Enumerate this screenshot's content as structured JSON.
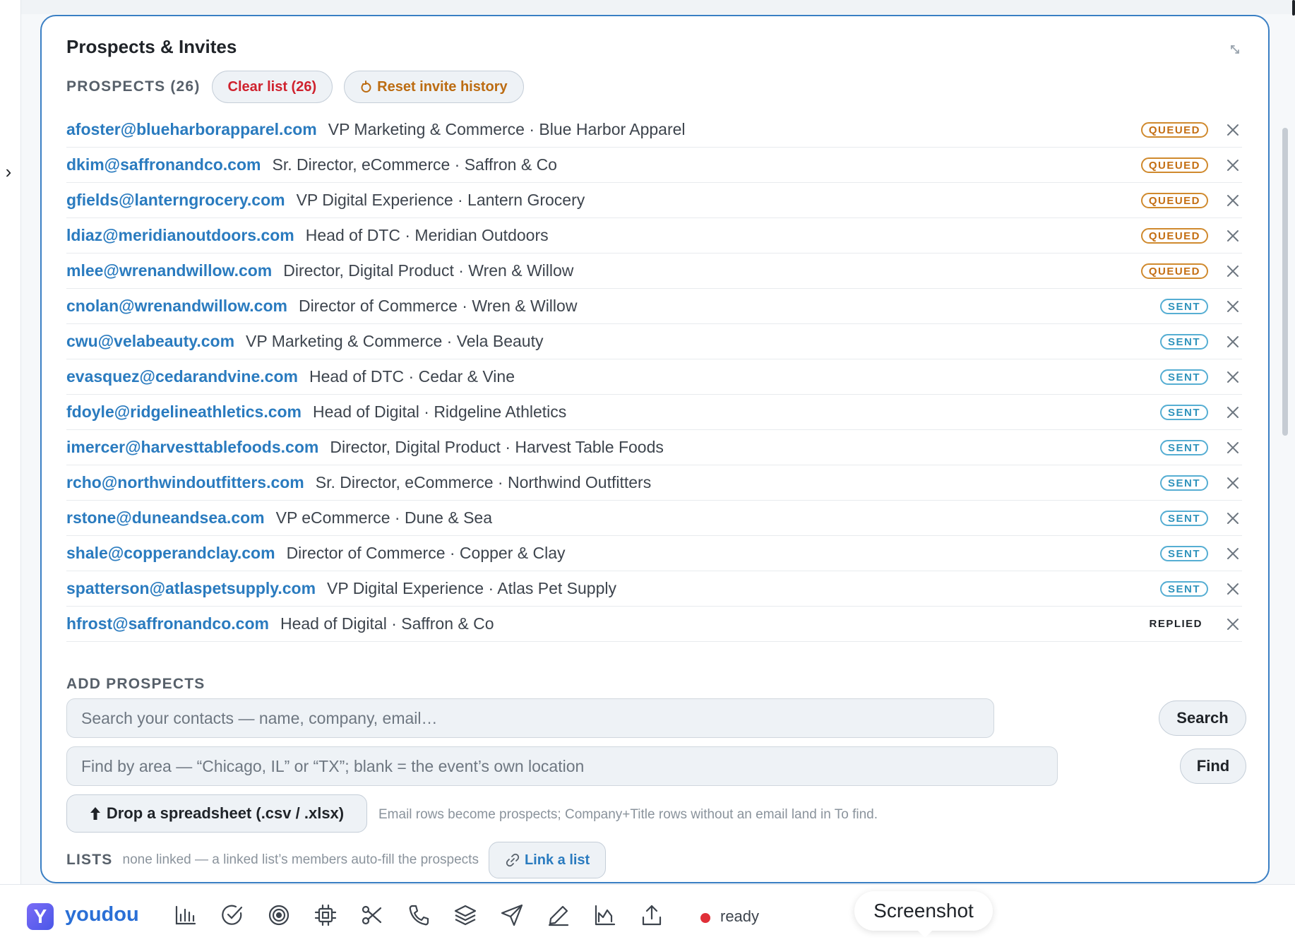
{
  "panel": {
    "title": "Prospects & Invites",
    "prospects_label": "PROSPECTS (26)",
    "clear_button": "Clear list (26)",
    "reset_button": "Reset invite history"
  },
  "prospects": [
    {
      "email": "afoster@blueharborapparel.com",
      "desc": "VP Marketing & Commerce · Blue Harbor Apparel",
      "status": "QUEUED"
    },
    {
      "email": "dkim@saffronandco.com",
      "desc": "Sr. Director, eCommerce · Saffron & Co",
      "status": "QUEUED"
    },
    {
      "email": "gfields@lanterngrocery.com",
      "desc": "VP Digital Experience · Lantern Grocery",
      "status": "QUEUED"
    },
    {
      "email": "ldiaz@meridianoutdoors.com",
      "desc": "Head of DTC · Meridian Outdoors",
      "status": "QUEUED"
    },
    {
      "email": "mlee@wrenandwillow.com",
      "desc": "Director, Digital Product · Wren & Willow",
      "status": "QUEUED"
    },
    {
      "email": "cnolan@wrenandwillow.com",
      "desc": "Director of Commerce · Wren & Willow",
      "status": "SENT"
    },
    {
      "email": "cwu@velabeauty.com",
      "desc": "VP Marketing & Commerce · Vela Beauty",
      "status": "SENT"
    },
    {
      "email": "evasquez@cedarandvine.com",
      "desc": "Head of DTC · Cedar & Vine",
      "status": "SENT"
    },
    {
      "email": "fdoyle@ridgelineathletics.com",
      "desc": "Head of Digital · Ridgeline Athletics",
      "status": "SENT"
    },
    {
      "email": "imercer@harvesttablefoods.com",
      "desc": "Director, Digital Product · Harvest Table Foods",
      "status": "SENT"
    },
    {
      "email": "rcho@northwindoutfitters.com",
      "desc": "Sr. Director, eCommerce · Northwind Outfitters",
      "status": "SENT"
    },
    {
      "email": "rstone@duneandsea.com",
      "desc": "VP eCommerce · Dune & Sea",
      "status": "SENT"
    },
    {
      "email": "shale@copperandclay.com",
      "desc": "Director of Commerce · Copper & Clay",
      "status": "SENT"
    },
    {
      "email": "spatterson@atlaspetsupply.com",
      "desc": "VP Digital Experience · Atlas Pet Supply",
      "status": "SENT"
    },
    {
      "email": "hfrost@saffronandco.com",
      "desc": "Head of Digital · Saffron & Co",
      "status": "REPLIED"
    }
  ],
  "add": {
    "label": "ADD PROSPECTS",
    "search_placeholder": "Search your contacts — name, company, email…",
    "search_button": "Search",
    "area_placeholder": "Find by area — “Chicago, IL” or “TX”; blank = the event’s own location",
    "find_button": "Find",
    "drop_button": "Drop a spreadsheet (.csv / .xlsx)",
    "drop_hint": "Email rows become prospects; Company+Title rows without an email land in To find."
  },
  "lists": {
    "label": "LISTS",
    "hint": "none linked — a linked list’s members auto-fill the prospects",
    "link_button": "Link a list"
  },
  "taskbar": {
    "brand_letter": "Y",
    "brand": "youdou",
    "icons": [
      "bar-chart-icon",
      "check-circle-icon",
      "target-icon",
      "chip-icon",
      "scissors-icon",
      "phone-icon",
      "layers-icon",
      "send-icon",
      "pencil-icon",
      "area-chart-icon",
      "upload-icon"
    ],
    "status": "ready",
    "tooltip": "Screenshot"
  },
  "colors": {
    "accent": "#3a7fc4",
    "link": "#2a7bbf",
    "queued": "#c46e12",
    "sent": "#2f93bc",
    "danger": "#cf222e",
    "status_dot": "#e02f38"
  }
}
